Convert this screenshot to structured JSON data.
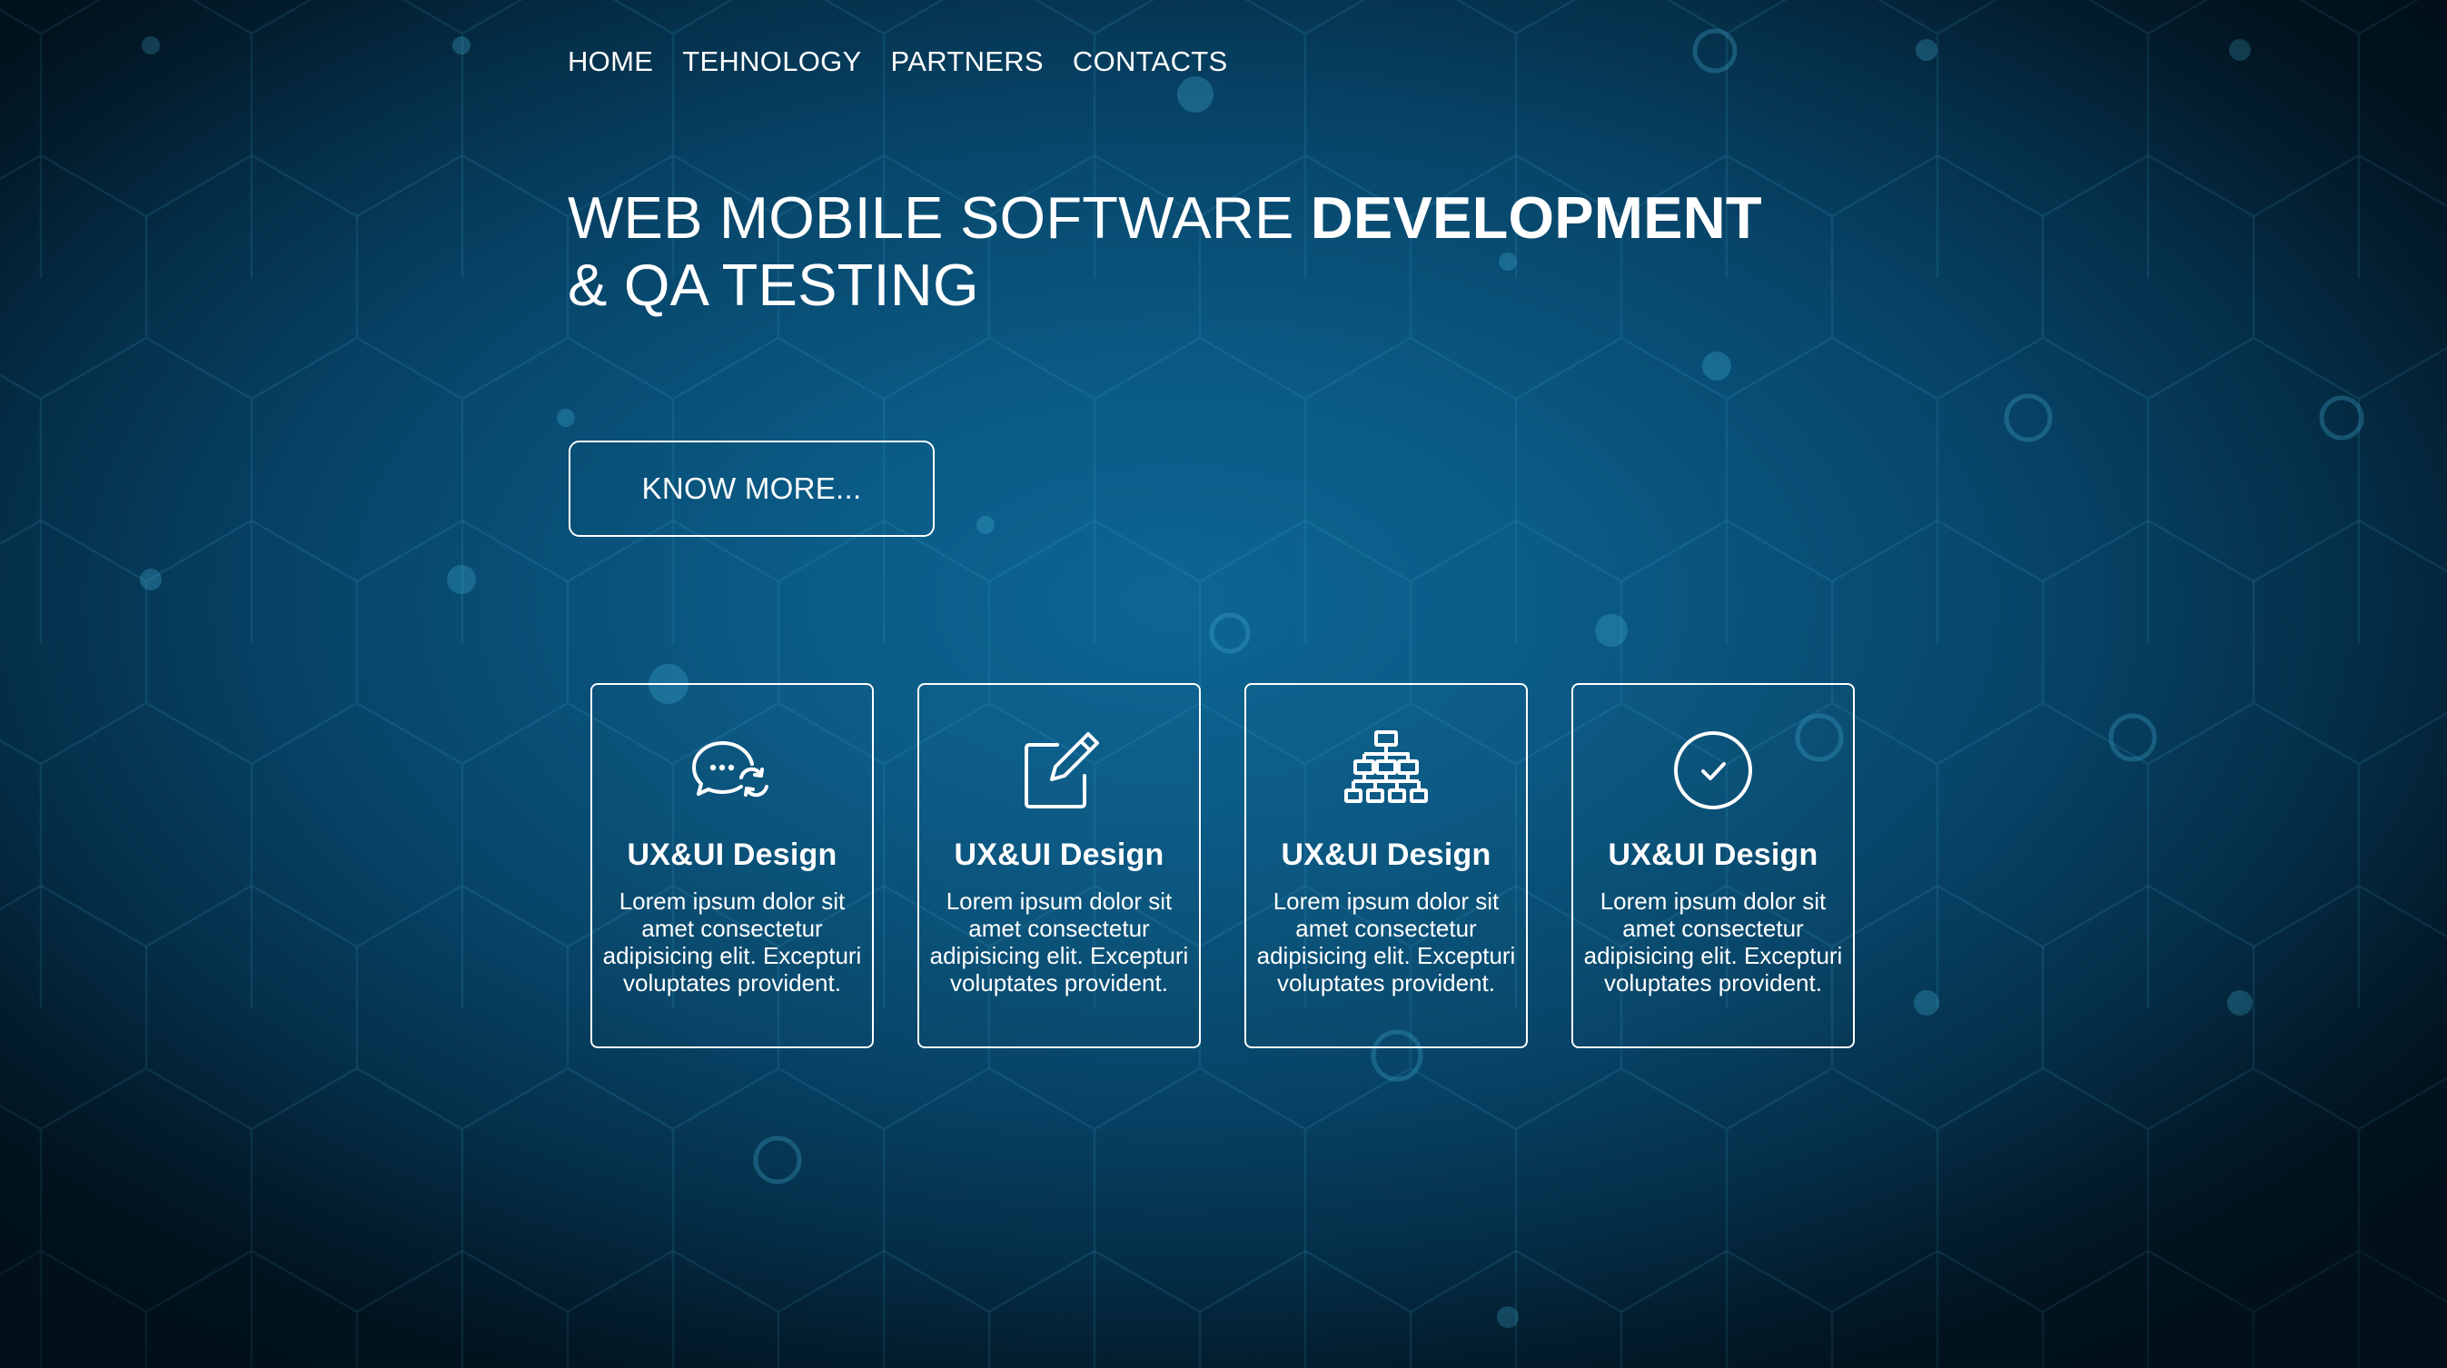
{
  "nav": {
    "items": [
      "HOME",
      "TEHNOLOGY",
      "PARTNERS",
      "CONTACTS"
    ]
  },
  "hero": {
    "line1_regular": "WEB MOBILE SOFTWARE ",
    "line1_bold": "DEVELOPMENT",
    "line2": "& QA TESTING"
  },
  "cta": {
    "label": "KNOW MORE..."
  },
  "cards": [
    {
      "icon": "chat-refresh-icon",
      "title": "UX&UI Design",
      "text": "Lorem ipsum dolor sit amet consectetur adipisicing elit. Excepturi voluptates provident."
    },
    {
      "icon": "edit-icon",
      "title": "UX&UI Design",
      "text": "Lorem ipsum dolor sit amet consectetur adipisicing elit. Excepturi voluptates provident."
    },
    {
      "icon": "sitemap-icon",
      "title": "UX&UI Design",
      "text": "Lorem ipsum dolor sit amet consectetur adipisicing elit. Excepturi voluptates provident."
    },
    {
      "icon": "check-circle-icon",
      "title": "UX&UI Design",
      "text": "Lorem ipsum dolor sit amet consectetur adipisicing elit. Excepturi voluptates provident."
    }
  ],
  "colors": {
    "background_center": "#0d6694",
    "background_edge": "#021b2b",
    "pattern_line": "#3fa9cf",
    "text": "#ffffff"
  }
}
